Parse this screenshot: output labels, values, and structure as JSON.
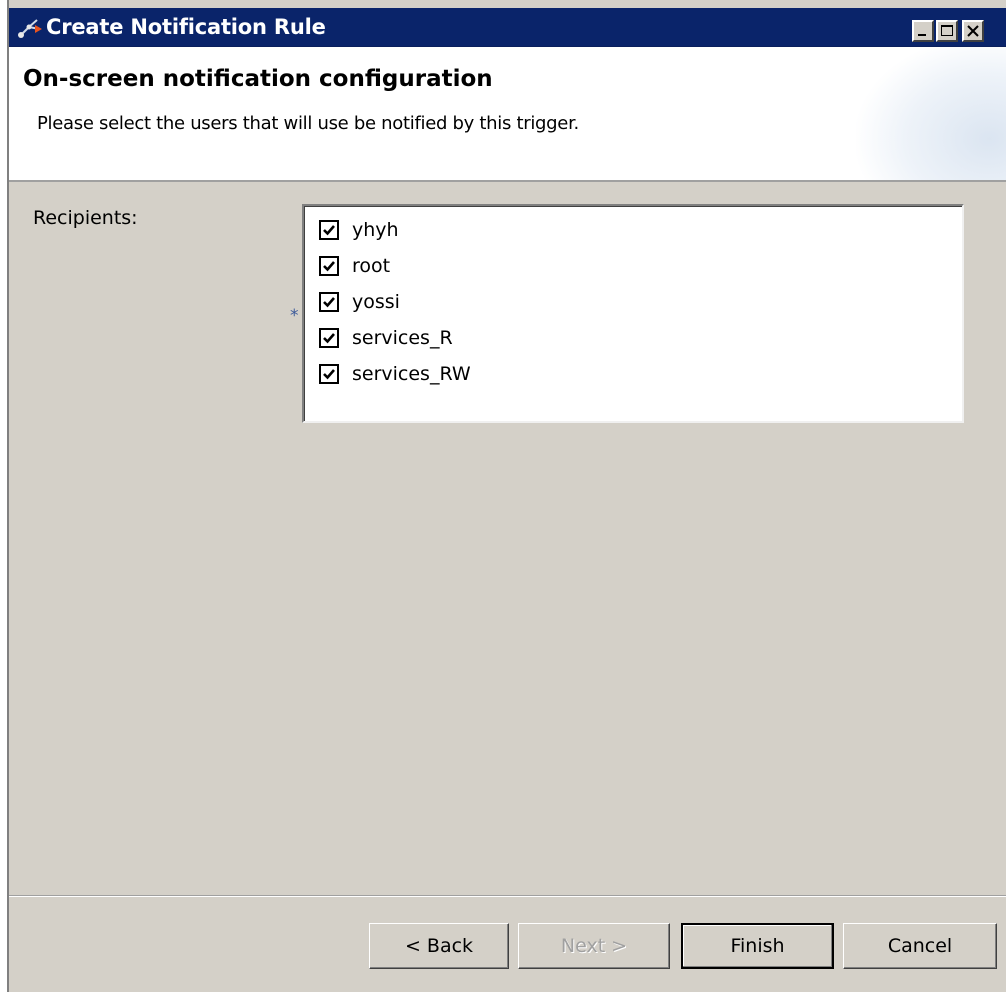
{
  "window": {
    "title": "Create Notification Rule"
  },
  "header": {
    "title": "On-screen notification configuration",
    "description": "Please select the users that will use be notified by this trigger."
  },
  "form": {
    "recipients_label": "Recipients:",
    "required_marker": "*",
    "recipients": [
      {
        "label": "yhyh",
        "checked": true
      },
      {
        "label": "root",
        "checked": true
      },
      {
        "label": "yossi",
        "checked": true
      },
      {
        "label": "services_R",
        "checked": true
      },
      {
        "label": "services_RW",
        "checked": true
      }
    ]
  },
  "footer": {
    "back_label": "< Back",
    "next_label": "Next >",
    "finish_label": "Finish",
    "cancel_label": "Cancel",
    "next_enabled": false
  },
  "colors": {
    "titlebar": "#0a246a",
    "dialog_bg": "#d4d0c8",
    "header_bg": "#ffffff"
  }
}
